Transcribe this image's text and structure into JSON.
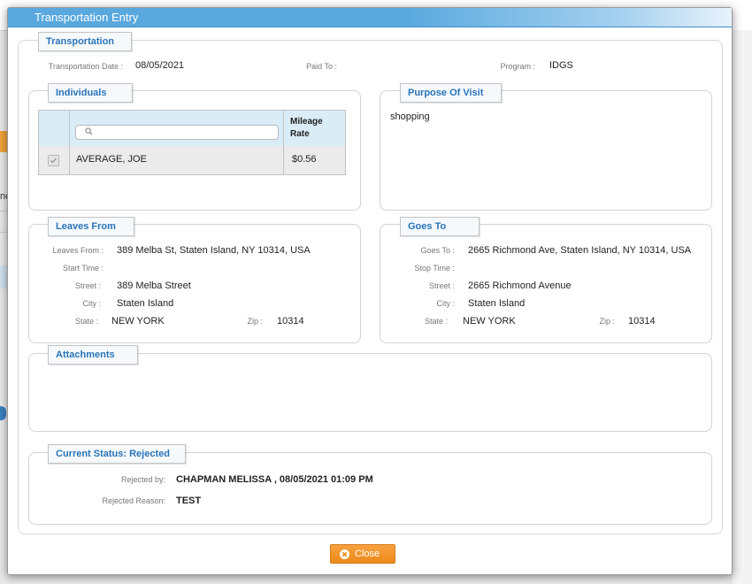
{
  "background": {
    "partial_text": "nc"
  },
  "modal": {
    "title": "Transportation Entry",
    "close_label": "Close"
  },
  "transportation": {
    "legend": "Transportation",
    "date_label": "Transportation Date :",
    "date_value": "08/05/2021",
    "paid_to_label": "Paid To :",
    "paid_to_value": "",
    "program_label": "Program :",
    "program_value": "IDGS"
  },
  "individuals": {
    "legend": "Individuals",
    "search_placeholder": "",
    "mileage_header_line1": "Mileage",
    "mileage_header_line2": "Rate",
    "rows": [
      {
        "name": "AVERAGE, JOE",
        "rate": "$0.56",
        "checked": true
      }
    ]
  },
  "purpose": {
    "legend": "Purpose Of Visit",
    "text": "shopping"
  },
  "leaves_from": {
    "legend": "Leaves From",
    "address_label": "Leaves From :",
    "address_value": "389 Melba St, Staten Island, NY 10314, USA",
    "time_label": "Start Time :",
    "time_value": "",
    "street_label": "Street :",
    "street_value": "389 Melba Street",
    "city_label": "City :",
    "city_value": "Staten Island",
    "state_label": "State :",
    "state_value": "NEW YORK",
    "zip_label": "Zip :",
    "zip_value": "10314"
  },
  "goes_to": {
    "legend": "Goes To",
    "address_label": "Goes To :",
    "address_value": "2665 Richmond Ave, Staten Island, NY 10314, USA",
    "time_label": "Stop Time :",
    "time_value": "",
    "street_label": "Street :",
    "street_value": "2665 Richmond Avenue",
    "city_label": "City :",
    "city_value": "Staten Island",
    "state_label": "State :",
    "state_value": "NEW YORK",
    "zip_label": "Zip :",
    "zip_value": "10314"
  },
  "attachments": {
    "legend": "Attachments"
  },
  "status": {
    "legend": "Current Status: Rejected",
    "rejected_by_label": "Rejected by:",
    "rejected_by_value": "CHAPMAN MELISSA , 08/05/2021 01:09 PM",
    "reason_label": "Rejected Reason:",
    "reason_value": "TEST"
  },
  "colors": {
    "titlebar": "#5aa9de",
    "legend_text": "#2a74b8",
    "close_button": "#f29530"
  },
  "icons": {
    "search": "search-icon",
    "close": "close-circle-icon",
    "checkbox": "checkbox-checked-icon"
  }
}
